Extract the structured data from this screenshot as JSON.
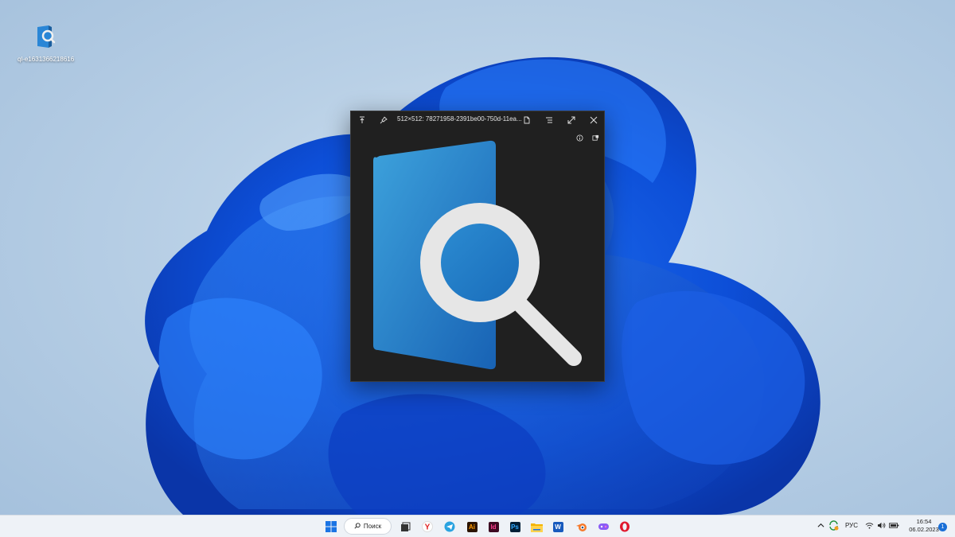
{
  "desktop": {
    "icons": [
      {
        "label": "ql-e1631366218616",
        "icon": "quicklook-app-icon"
      }
    ]
  },
  "viewer": {
    "title": "512×512: 78271958-2391be00-750d-11ea...",
    "toolbar": [
      "pin-to-top-icon",
      "pin-icon",
      "open-file-icon",
      "open-with-icon",
      "fullscreen-icon",
      "close-icon"
    ],
    "subtoolbar": [
      "info-icon",
      "theme-icon"
    ],
    "preview_subject": "quicklook-app-icon",
    "colors": {
      "background": "#202020",
      "doc_blue": "#1f74c4",
      "lens_white": "#e6e6e6"
    }
  },
  "taskbar": {
    "search_label": "Поиск",
    "apps": [
      "windows-start-icon",
      "task-view-icon",
      "yandex-browser-icon",
      "telegram-icon",
      "illustrator-icon",
      "indesign-icon",
      "photoshop-icon",
      "file-explorer-icon",
      "word-icon",
      "blender-icon",
      "game-app-icon",
      "opera-icon"
    ],
    "app_letters": {
      "illustrator": "Ai",
      "indesign": "Id",
      "photoshop": "Ps",
      "word": "W",
      "yandex": "Y"
    },
    "tray": {
      "language": "РУС",
      "time": "16:54",
      "date": "06.02.2023",
      "notifications": "1"
    }
  }
}
